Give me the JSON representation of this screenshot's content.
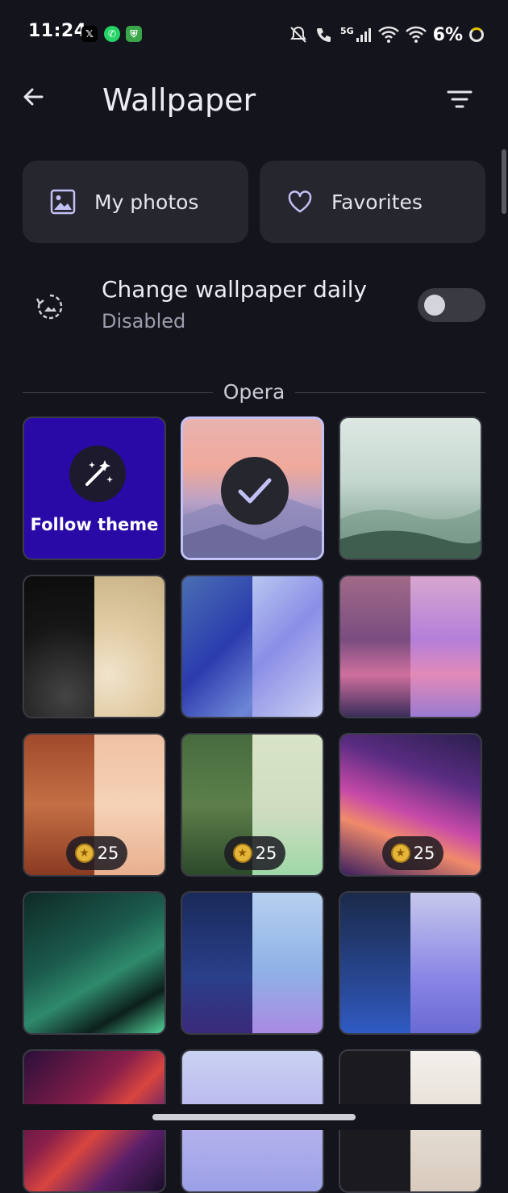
{
  "status_bar": {
    "time": "11:24",
    "network": "5G",
    "battery": "6%",
    "notification_icons": [
      "x-icon",
      "whatsapp-icon",
      "shield-icon"
    ],
    "system_icons": [
      "mute-icon",
      "wifi-calling-icon",
      "cell-signal-icon",
      "wifi-icon",
      "wifi-icon"
    ]
  },
  "header": {
    "title": "Wallpaper"
  },
  "quick_actions": {
    "my_photos": "My photos",
    "favorites": "Favorites"
  },
  "daily": {
    "title": "Change wallpaper daily",
    "status": "Disabled",
    "enabled": false
  },
  "section": {
    "label": "Opera"
  },
  "tiles": {
    "follow_theme": {
      "label": "Follow theme"
    },
    "price_1": "25",
    "price_2": "25",
    "price_3": "25"
  },
  "colors": {
    "background": "#14141c",
    "card": "#26262f",
    "accent": "#c2c1f5",
    "follow_theme_bg": "#2a0aa6"
  }
}
